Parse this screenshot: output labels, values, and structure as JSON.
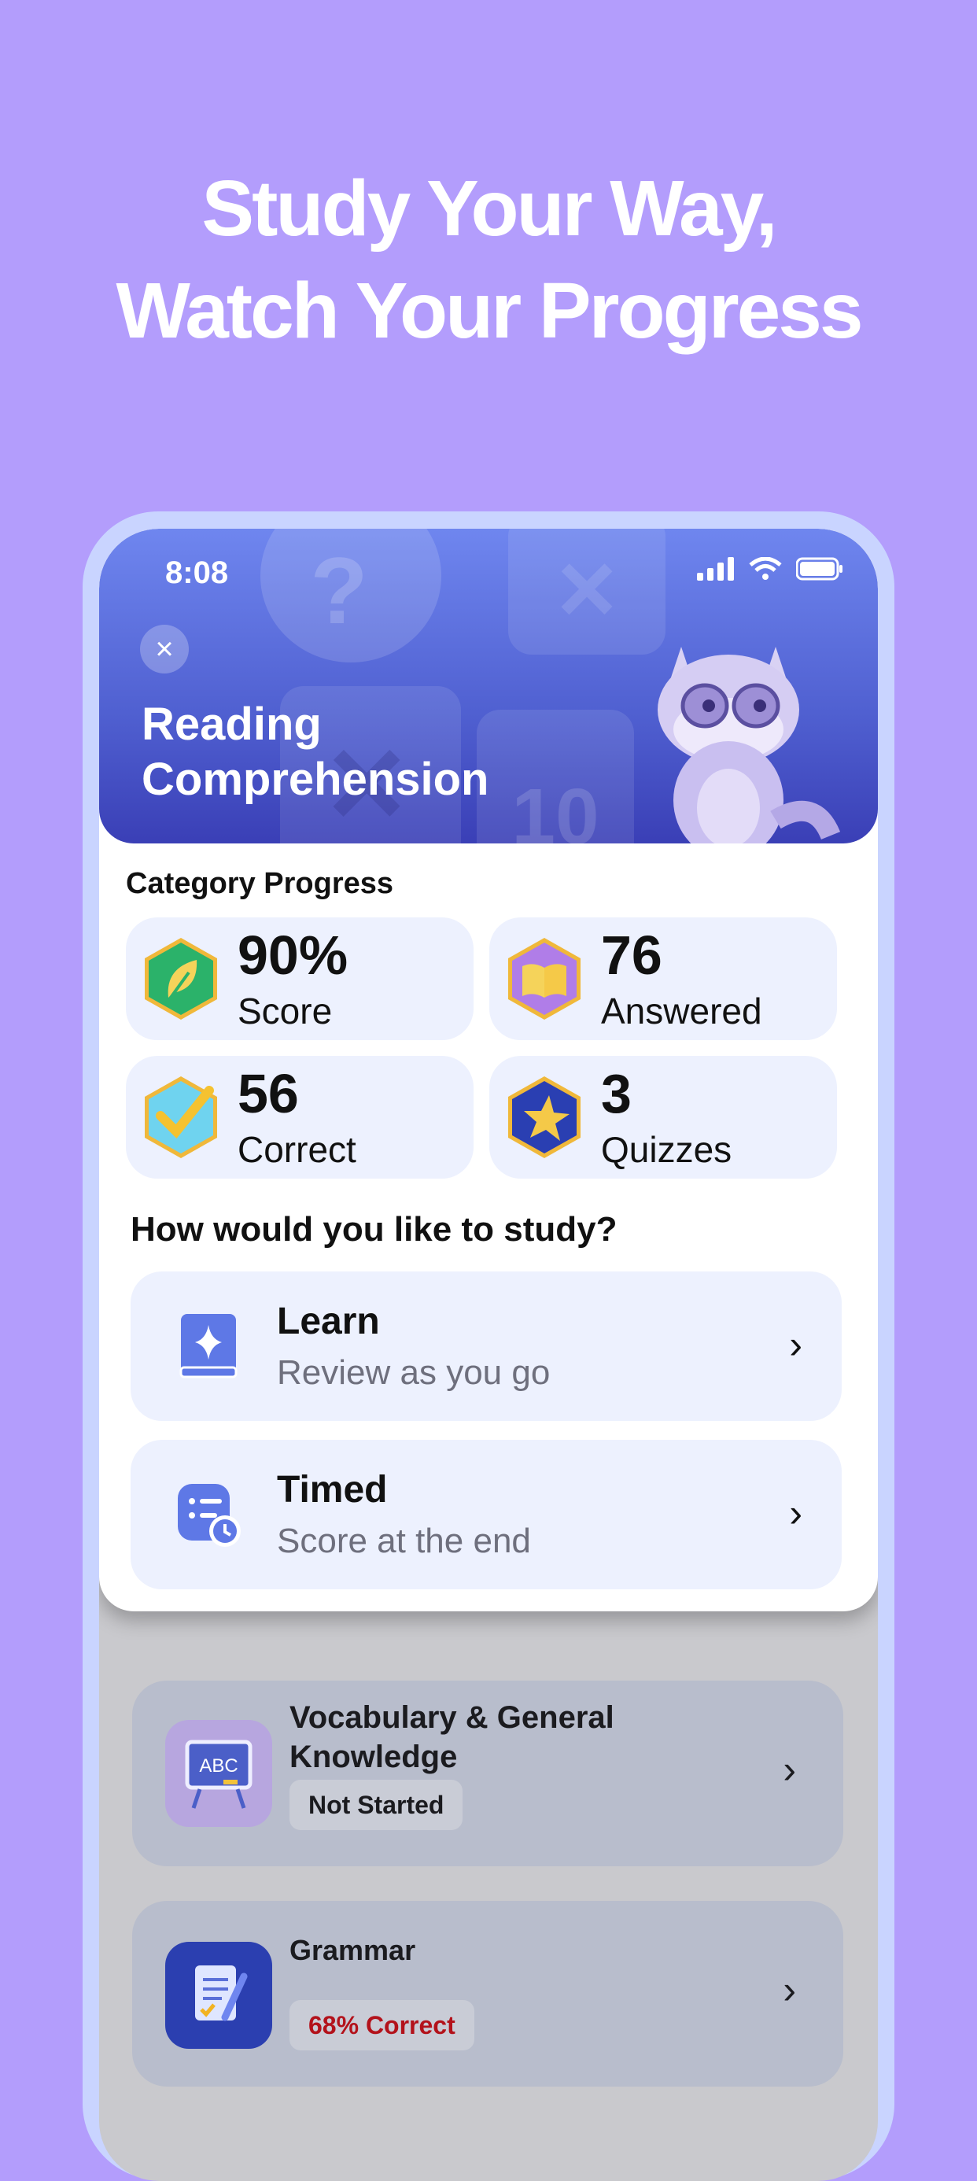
{
  "headline": {
    "line1": "Study Your Way,",
    "line2": "Watch Your Progress"
  },
  "status_bar": {
    "time": "8:08"
  },
  "header": {
    "title_line1": "Reading",
    "title_line2": "Comprehension",
    "close_icon": "close-icon"
  },
  "progress": {
    "section_label": "Category Progress",
    "stats": [
      {
        "value": "90%",
        "label": "Score",
        "icon": "leaf-hex-icon"
      },
      {
        "value": "76",
        "label": "Answered",
        "icon": "book-hex-icon"
      },
      {
        "value": "56",
        "label": "Correct",
        "icon": "check-hex-icon"
      },
      {
        "value": "3",
        "label": "Quizzes",
        "icon": "star-hex-icon"
      }
    ]
  },
  "study": {
    "question": "How would you like to study?",
    "modes": [
      {
        "title": "Learn",
        "subtitle": "Review as you go",
        "icon": "book-sparkle-icon"
      },
      {
        "title": "Timed",
        "subtitle": "Score at the end",
        "icon": "list-clock-icon"
      }
    ]
  },
  "categories": [
    {
      "title_line1": "Vocabulary & General",
      "title_line2": "Knowledge",
      "status": "Not Started",
      "icon": "abc-board-icon"
    },
    {
      "title_line1": "Grammar",
      "status": "68% Correct",
      "status_color": "#b3121b",
      "icon": "document-pen-icon"
    }
  ]
}
